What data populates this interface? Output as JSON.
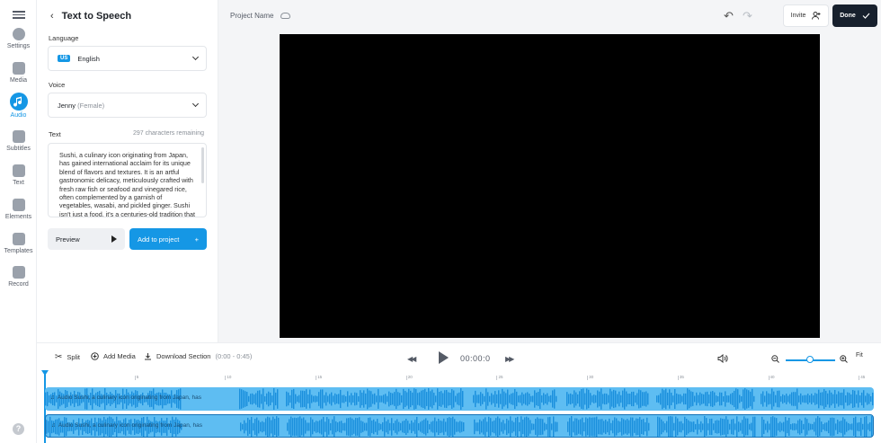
{
  "rail": {
    "items": [
      {
        "label": "Settings",
        "icon": "gear-icon"
      },
      {
        "label": "Media",
        "icon": "plus-icon"
      },
      {
        "label": "Audio",
        "icon": "music-note-icon",
        "active": true
      },
      {
        "label": "Subtitles",
        "icon": "subtitles-icon"
      },
      {
        "label": "Text",
        "icon": "text-icon"
      },
      {
        "label": "Elements",
        "icon": "elements-icon"
      },
      {
        "label": "Templates",
        "icon": "templates-icon"
      },
      {
        "label": "Record",
        "icon": "record-icon"
      }
    ],
    "help": "?"
  },
  "panel": {
    "title": "Text to Speech",
    "back": "‹",
    "language_label": "Language",
    "language_flag": "US",
    "language_value": "English",
    "voice_label": "Voice",
    "voice_name": "Jenny",
    "voice_gender": "(Female)",
    "text_label": "Text",
    "remaining": "297 characters remaining",
    "text_value": "Sushi, a culinary icon originating from Japan, has gained international acclaim for its unique blend of flavors and textures. It is an artful gastronomic delicacy, meticulously crafted with fresh raw fish or seafood and vinegared rice, often complemented by a garnish of vegetables, wasabi, and pickled ginger. Sushi isn't just a food, it's a centuries-old tradition that embodies the Japanese appreciation for",
    "preview_label": "Preview",
    "add_label": "Add to project",
    "add_icon": "+"
  },
  "topbar": {
    "project_name": "Project Name",
    "undo": "↶",
    "redo": "↷",
    "invite_label": "Invite",
    "done_label": "Done"
  },
  "timeline": {
    "split_label": "Split",
    "add_media_label": "Add Media",
    "download_label": "Download Section",
    "download_range": "(0:00 - 0:45)",
    "time": "00:00:0",
    "fit_label": "Fit",
    "zoom_level": 0.45,
    "ruler_labels": [
      "0",
      "5",
      "10",
      "15",
      "20",
      "25",
      "30",
      "35",
      "40",
      "45"
    ],
    "tracks": [
      {
        "label": "Audio Sushi, a culinary icon originating from Japan, has"
      },
      {
        "label": "Audio Sushi, a culinary icon originating from Japan, has"
      }
    ]
  },
  "colors": {
    "accent": "#1597e5",
    "dark": "#17202d",
    "track": "#5ebdf2"
  }
}
